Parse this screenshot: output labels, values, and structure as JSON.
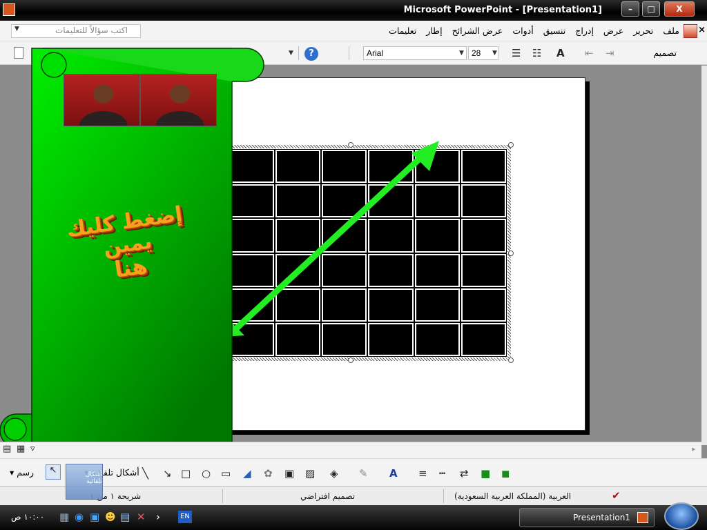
{
  "window": {
    "title": "Microsoft PowerPoint - [Presentation1]",
    "buttons": {
      "minimize": "–",
      "maximize": "□",
      "close": "X"
    }
  },
  "menubar": {
    "ask_placeholder": "اكتب سؤالاً للتعليمات",
    "items": [
      "ملف",
      "تحرير",
      "عرض",
      "إدراج",
      "تنسيق",
      "أدوات",
      "عرض الشرائح",
      "إطار",
      "تعليمات"
    ]
  },
  "toolbar": {
    "font": "Arial",
    "size": "28",
    "design": "تصميم"
  },
  "slide_overlay": {
    "wordart_line1": "إضغط كليك يمين",
    "wordart_line2": "هنا"
  },
  "drawing": {
    "draw_label": "رسم",
    "autoshapes_label": "أشكال تلقائية"
  },
  "status": {
    "slide_position": "شريحة ١ من ١",
    "design_name": "تصميم افتراضي",
    "language": "العربية (المملكة العربية السعودية)"
  },
  "taskbar": {
    "time": "١٠:٠٠ ص",
    "language_indicator": "EN",
    "task_label": "Presentation1"
  },
  "colors": {
    "scroll_green_light": "#00f000",
    "scroll_green_dark": "#007800",
    "arrow_green": "#22ee22",
    "wordart_orange": "#f6a21c"
  }
}
